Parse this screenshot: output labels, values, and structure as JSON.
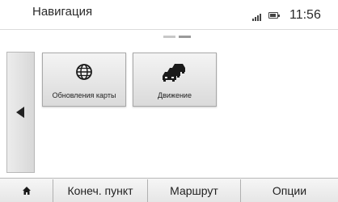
{
  "header": {
    "title": "Навигация",
    "clock": "11:56"
  },
  "pager": {
    "pages": 2,
    "active_page": 2
  },
  "tiles": [
    {
      "label": "Обновления карты",
      "icon": "globe-icon"
    },
    {
      "label": "Движение",
      "icon": "traffic-cars-icon"
    }
  ],
  "bottom_bar": {
    "home_icon": "home-icon",
    "destination_label": "Конеч. пункт",
    "route_label": "Маршрут",
    "options_label": "Опции"
  }
}
